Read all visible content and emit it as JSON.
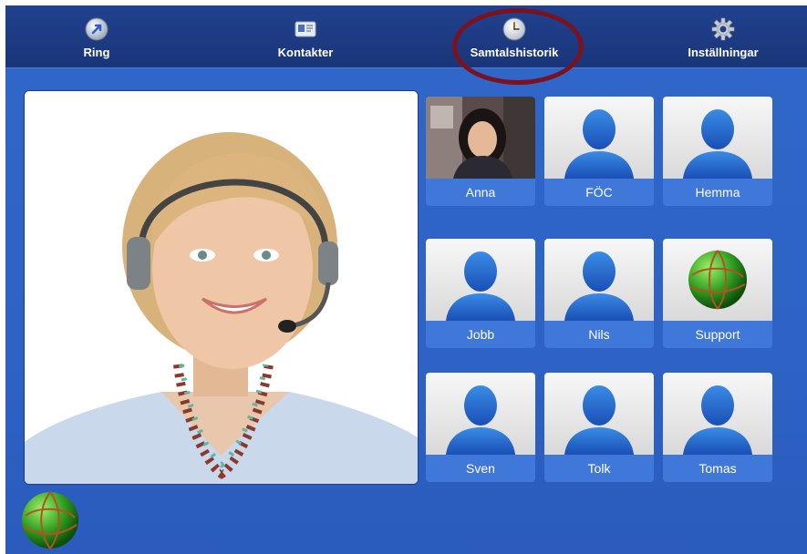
{
  "nav": {
    "ring": "Ring",
    "kontakter": "Kontakter",
    "samtalshistorik": "Samtalshistorik",
    "installningar": "Inställningar"
  },
  "contacts": [
    {
      "name": "Anna",
      "icon": "photo"
    },
    {
      "name": "FÖC",
      "icon": "person-silhouette"
    },
    {
      "name": "Hemma",
      "icon": "person-silhouette"
    },
    {
      "name": "Jobb",
      "icon": "person-silhouette"
    },
    {
      "name": "Nils",
      "icon": "person-silhouette"
    },
    {
      "name": "Support",
      "icon": "globe"
    },
    {
      "name": "Sven",
      "icon": "person-silhouette"
    },
    {
      "name": "Tolk",
      "icon": "person-silhouette"
    },
    {
      "name": "Tomas",
      "icon": "person-silhouette"
    }
  ],
  "colors": {
    "background": "#2e63c5",
    "topbar": "#1f3f8a",
    "tile_label": "#3f78d8",
    "highlight_ring": "#7a1220"
  }
}
